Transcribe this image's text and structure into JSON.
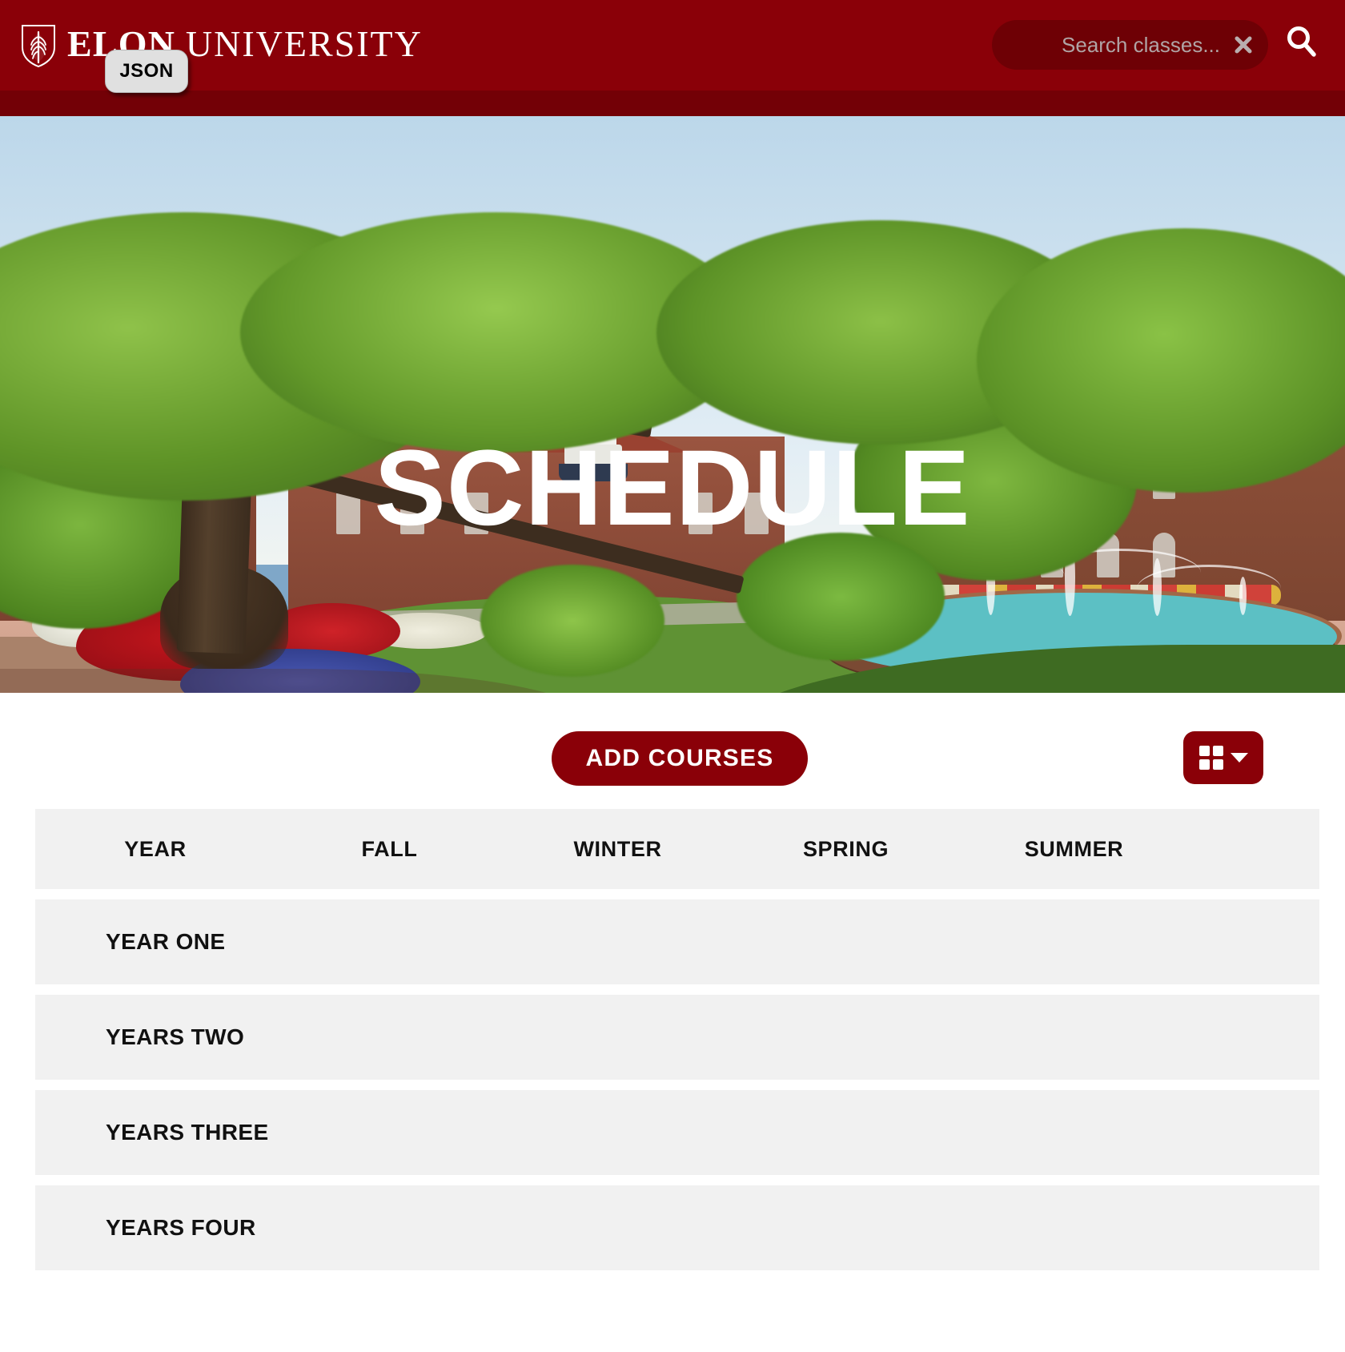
{
  "header": {
    "brand_bold": "ELON",
    "brand_light": "UNIVERSITY",
    "logo_icon": "elon-shield-leaf-icon",
    "search": {
      "placeholder": "Search classes...",
      "value": "",
      "clear_icon": "close-x-icon",
      "submit_icon": "magnifier-search-icon"
    },
    "bar_color": "#8a0008",
    "strip_color": "#730006"
  },
  "hero": {
    "title": "SCHEDULE",
    "title_color": "#ffffff",
    "scene": "elon-campus-fountain-photo"
  },
  "toolbar": {
    "json_label": "JSON",
    "add_courses_label": "ADD COURSES",
    "view_toggle_icon": "grid-view-icon",
    "view_toggle_caret_icon": "chevron-down-icon",
    "accent_color": "#8a0008"
  },
  "schedule": {
    "columns": [
      {
        "key": "year",
        "label": "YEAR"
      },
      {
        "key": "fall",
        "label": "FALL"
      },
      {
        "key": "winter",
        "label": "WINTER"
      },
      {
        "key": "spring",
        "label": "SPRING"
      },
      {
        "key": "summer",
        "label": "SUMMER"
      }
    ],
    "rows": [
      {
        "year": "YEAR ONE",
        "fall": "",
        "winter": "",
        "spring": "",
        "summer": ""
      },
      {
        "year": "YEARS TWO",
        "fall": "",
        "winter": "",
        "spring": "",
        "summer": ""
      },
      {
        "year": "YEARS THREE",
        "fall": "",
        "winter": "",
        "spring": "",
        "summer": ""
      },
      {
        "year": "YEARS FOUR",
        "fall": "",
        "winter": "",
        "spring": "",
        "summer": ""
      }
    ],
    "row_bg": "#f1f1f1"
  }
}
